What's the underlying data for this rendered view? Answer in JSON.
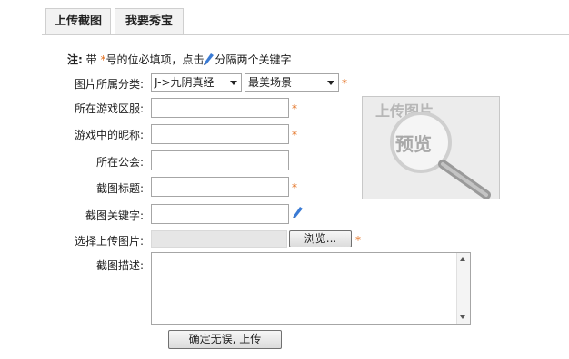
{
  "tabs": [
    {
      "label": "上传截图"
    },
    {
      "label": "我要秀宝"
    }
  ],
  "note": {
    "prefix": "注:",
    "text_before_star": "带 ",
    "star": "*",
    "text_after_star": "号的位必填项，点击",
    "text_after_icon": "分隔两个关键字"
  },
  "form": {
    "category_label": "图片所属分类:",
    "category_value": "J->九阴真经",
    "scene_value": "最美场景",
    "server_label": "所在游戏区服:",
    "nickname_label": "游戏中的昵称:",
    "guild_label": "所在公会:",
    "title_label": "截图标题:",
    "keyword_label": "截图关键字:",
    "file_label": "选择上传图片:",
    "browse_button": "浏览...",
    "desc_label": "截图描述:",
    "submit_button": "确定无误, 上传",
    "required_mark": "*"
  },
  "preview": {
    "title": "上传图片",
    "subtitle": "预览"
  },
  "colors": {
    "required_star": "#e36c1a",
    "pen_icon": "#3a7bd5"
  }
}
